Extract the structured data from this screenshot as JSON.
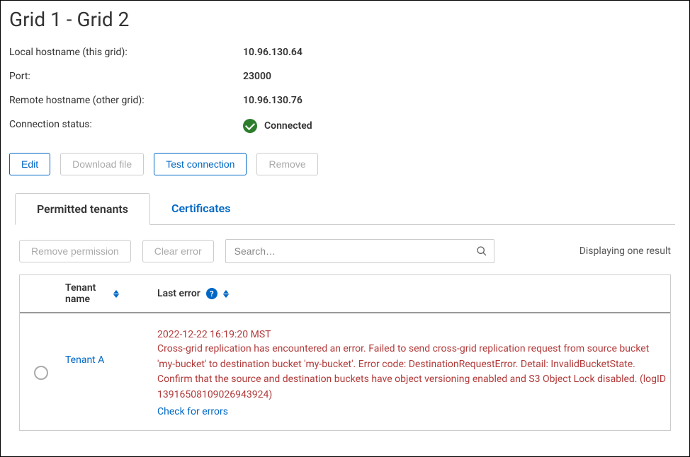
{
  "title": "Grid 1 - Grid 2",
  "info": {
    "local_label": "Local hostname (this grid):",
    "local_value": "10.96.130.64",
    "port_label": "Port:",
    "port_value": "23000",
    "remote_label": "Remote hostname (other grid):",
    "remote_value": "10.96.130.76",
    "status_label": "Connection status:",
    "status_value": "Connected"
  },
  "buttons": {
    "edit": "Edit",
    "download": "Download file",
    "test": "Test connection",
    "remove": "Remove"
  },
  "tabs": {
    "permitted": "Permitted tenants",
    "certificates": "Certificates"
  },
  "toolbar": {
    "remove_permission": "Remove permission",
    "clear_error": "Clear error",
    "search_placeholder": "Search…",
    "result_text": "Displaying one result"
  },
  "table": {
    "th_tenant": "Tenant name",
    "th_last_error": "Last error",
    "help_glyph": "?"
  },
  "row": {
    "tenant_name": "Tenant A",
    "error_timestamp": "2022-12-22 16:19:20 MST",
    "error_message": "Cross-grid replication has encountered an error. Failed to send cross-grid replication request from source bucket 'my-bucket' to destination bucket 'my-bucket'. Error code: DestinationRequestError. Detail: InvalidBucketState. Confirm that the source and destination buckets have object versioning enabled and S3 Object Lock disabled. (logID 13916508109026943924)",
    "check_link": "Check for errors"
  }
}
